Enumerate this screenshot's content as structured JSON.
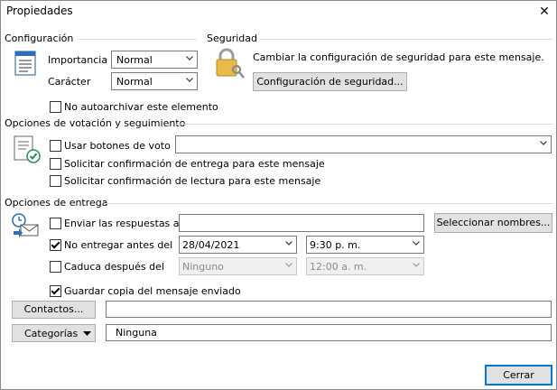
{
  "dialog": {
    "title": "Propiedades"
  },
  "configuracion": {
    "heading": "Configuración",
    "importancia_label": "Importancia",
    "importancia_value": "Normal",
    "caracter_label": "Carácter",
    "caracter_value": "Normal",
    "no_autoarchivar_label": "No autoarchivar este elemento"
  },
  "seguridad": {
    "heading": "Seguridad",
    "description": "Cambiar la configuración de seguridad para este mensaje.",
    "button_label": "Configuración de seguridad..."
  },
  "votacion": {
    "heading": "Opciones de votación y seguimiento",
    "usar_botones_label": "Usar botones de voto",
    "usar_botones_value": "",
    "confirm_entrega_label": "Solicitar confirmación de entrega para este mensaje",
    "confirm_lectura_label": "Solicitar confirmación de lectura para este mensaje"
  },
  "entrega": {
    "heading": "Opciones de entrega",
    "enviar_respuestas_label": "Enviar las respuestas a",
    "enviar_respuestas_value": "",
    "seleccionar_nombres_label": "Seleccionar nombres...",
    "no_entregar_label": "No entregar antes del",
    "no_entregar_checked": true,
    "no_entregar_date": "28/04/2021",
    "no_entregar_time": "9:30 p. m.",
    "caduca_label": "Caduca después del",
    "caduca_checked": false,
    "caduca_date": "Ninguno",
    "caduca_time": "12:00 a. m.",
    "guardar_copia_label": "Guardar copia del mensaje enviado",
    "guardar_copia_checked": true
  },
  "contactos": {
    "button_label": "Contactos...",
    "value": ""
  },
  "categorias": {
    "button_label": "Categorías",
    "value": "Ninguna"
  },
  "footer": {
    "cerrar_label": "Cerrar"
  },
  "colors": {
    "accent": "#0078d7",
    "disabled_text": "#8a8a8a",
    "button_bg": "#e1e1e1"
  }
}
